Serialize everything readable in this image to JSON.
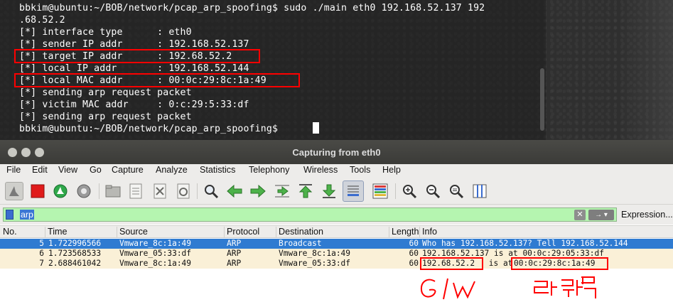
{
  "terminal": {
    "lines": [
      "bbkim@ubuntu:~/BOB/network/pcap_arp_spoofing$ sudo ./main eth0 192.168.52.137 192",
      ".68.52.2",
      "[*] interface type      : eth0",
      "[*] sender IP addr      : 192.168.52.137",
      "[*] target IP addr      : 192.68.52.2",
      "[*] local IP addr       : 192.168.52.144",
      "[*] local MAC addr      : 00:0c:29:8c:1a:49",
      "[*] sending arp request packet",
      "[*] victim MAC addr     : 0:c:29:5:33:df",
      "[*] sending arp request packet",
      "bbkim@ubuntu:~/BOB/network/pcap_arp_spoofing$ "
    ]
  },
  "wireshark": {
    "title": "Capturing from eth0",
    "menu": [
      "File",
      "Edit",
      "View",
      "Go",
      "Capture",
      "Analyze",
      "Statistics",
      "Telephony",
      "Wireless",
      "Tools",
      "Help"
    ],
    "toolbar_icons": [
      "shark-fin-start-icon",
      "stop-capture-icon",
      "restart-capture-icon",
      "capture-options-gear-icon",
      "open-folder-icon",
      "save-file-icon",
      "close-file-icon",
      "reload-file-icon",
      "find-packet-icon",
      "go-back-icon",
      "go-forward-icon",
      "go-to-packet-icon",
      "go-first-icon",
      "go-last-icon",
      "autoscroll-icon",
      "colorize-icon",
      "zoom-in-icon",
      "zoom-out-icon",
      "zoom-normal-icon",
      "resize-columns-icon"
    ],
    "filter": {
      "value": "arp",
      "apply_label": "→ ▾",
      "clear_label": "✕",
      "expression_label": "Expression..."
    },
    "columns": [
      "No.",
      "Time",
      "Source",
      "Protocol",
      "Destination",
      "Length",
      "Info"
    ],
    "packets": [
      {
        "no": "5",
        "time": "1.722996566",
        "source": "Vmware_8c:1a:49",
        "protocol": "ARP",
        "destination": "Broadcast",
        "length": "60",
        "info": "Who has 192.168.52.137? Tell 192.168.52.144",
        "selected": true
      },
      {
        "no": "6",
        "time": "1.723568533",
        "source": "Vmware_05:33:df",
        "protocol": "ARP",
        "destination": "Vmware_8c:1a:49",
        "length": "60",
        "info": "192.168.52.137 is at 00:0c:29:05:33:df",
        "selected": false
      },
      {
        "no": "7",
        "time": "2.688461042",
        "source": "Vmware_8c:1a:49",
        "protocol": "ARP",
        "destination": "Vmware_05:33:df",
        "length": "60",
        "info_parts": [
          "192.68.52.2",
          " is at ",
          "00:0c:29:8c:1a:49"
        ],
        "selected": false
      }
    ],
    "colors": {
      "selected_row": "#2f7bd1",
      "arp_row": "#faf0d7",
      "filter_ok": "#b5f5b0",
      "annotation": "#ff0000"
    }
  }
}
